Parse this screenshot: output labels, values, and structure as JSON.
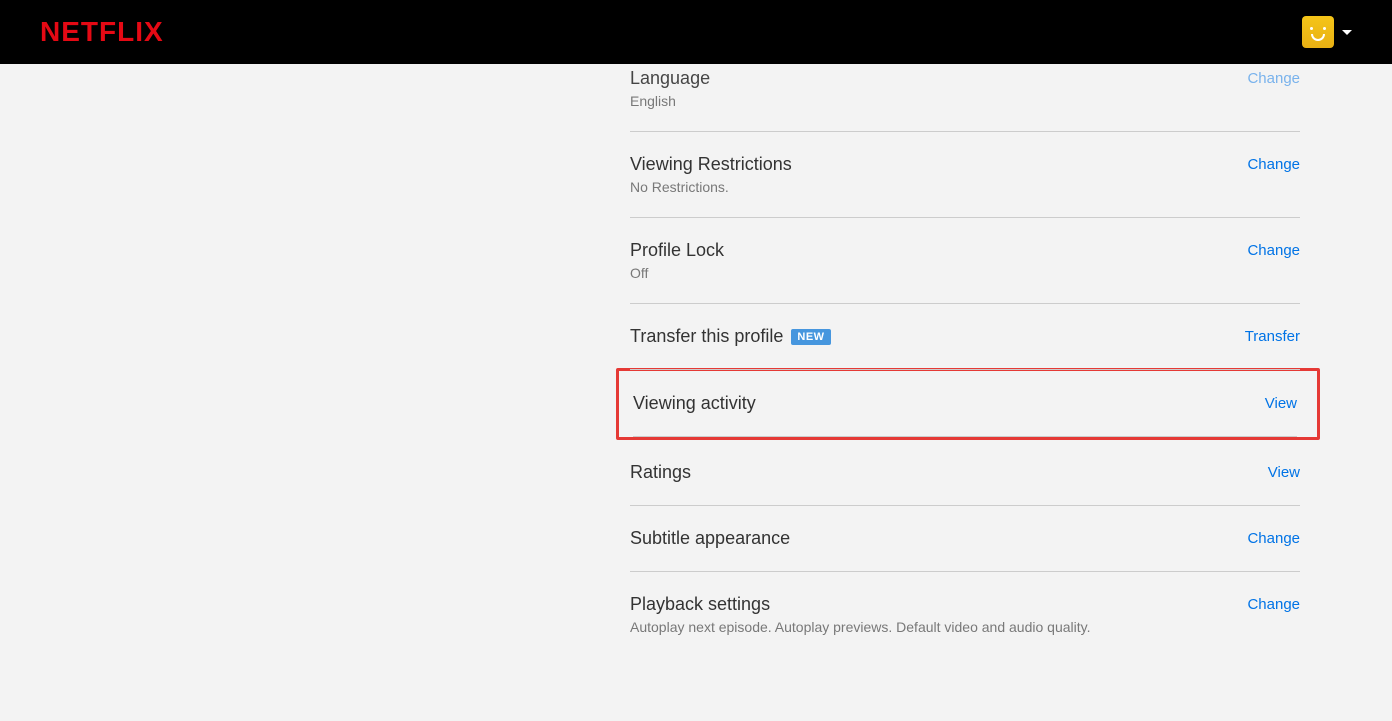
{
  "brand": "NETFLIX",
  "settings": [
    {
      "id": "language",
      "title": "Language",
      "subtitle": "English",
      "action": "Change"
    },
    {
      "id": "viewing-restrictions",
      "title": "Viewing Restrictions",
      "subtitle": "No Restrictions.",
      "action": "Change"
    },
    {
      "id": "profile-lock",
      "title": "Profile Lock",
      "subtitle": "Off",
      "action": "Change"
    },
    {
      "id": "transfer-profile",
      "title": "Transfer this profile",
      "badge": "NEW",
      "action": "Transfer"
    },
    {
      "id": "viewing-activity",
      "title": "Viewing activity",
      "action": "View",
      "highlighted": true
    },
    {
      "id": "ratings",
      "title": "Ratings",
      "action": "View"
    },
    {
      "id": "subtitle-appearance",
      "title": "Subtitle appearance",
      "action": "Change"
    },
    {
      "id": "playback-settings",
      "title": "Playback settings",
      "subtitle": "Autoplay next episode. Autoplay previews. Default video and audio quality.",
      "action": "Change"
    }
  ]
}
